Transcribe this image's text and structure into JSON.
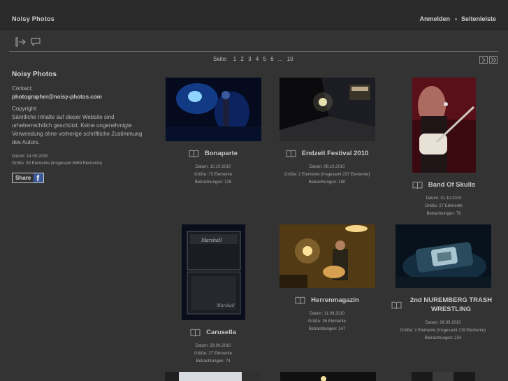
{
  "header": {
    "site_title": "Noisy Photos",
    "login": "Anmelden",
    "sitemap": "Seitenleiste"
  },
  "pager": {
    "label": "Seite:",
    "pages": [
      "1",
      "2",
      "3",
      "4",
      "5",
      "6",
      "...",
      "10"
    ]
  },
  "sidebar": {
    "title": "Noisy Photos",
    "contact_label": "Contact:",
    "contact_email": "photographer@noisy-photos.com",
    "copyright_label": "Copyright:",
    "copyright_text": "Sämtliche Inhalte auf dieser Website sind urheberrechtlich geschützt. Keine ungenehmigte Verwendung ohne vorherige schriftliche Zustimmung des Autors.",
    "date_line": "Datum: 14.09.2008",
    "size_line": "Größe: 83 Elemente (insgesamt 6069 Elemente)",
    "share_label": "Share"
  },
  "galleries": [
    {
      "title": "Bonaparte",
      "date": "Datum: 10.10.2010",
      "size": "Größe: 73 Elemente",
      "views": "Betrachtungen: 125"
    },
    {
      "title": "Endzeit Festival 2010",
      "date": "Datum: 08.10.2010",
      "size": "Größe: 2 Elemente (insgesamt 237 Elemente)",
      "views": "Betrachtungen: 180"
    },
    {
      "title": "Band Of Skulls",
      "date": "Datum: 01.10.2010",
      "size": "Größe: 27 Elemente",
      "views": "Betrachtungen: 79"
    },
    {
      "title": "Carusella",
      "date": "Datum: 29.09.2010",
      "size": "Größe: 27 Elemente",
      "views": "Betrachtungen: 74"
    },
    {
      "title": "Herrenmagazin",
      "date": "Datum: 11.09.2010",
      "size": "Größe: 36 Elemente",
      "views": "Betrachtungen: 147"
    },
    {
      "title": "2nd NUREMBERG TRASH WRESTLING",
      "date": "Datum: 06.09.2010",
      "size": "Größe: 2 Elemente (insgesamt 219 Elemente)",
      "views": "Betrachtungen: 234"
    }
  ],
  "icons": {
    "toolbar": [
      "exit-icon",
      "comment-icon"
    ],
    "caption": "album-book-icon",
    "nav": [
      "next-page-icon",
      "last-page-icon"
    ]
  },
  "colors": {
    "background": "#333333",
    "topbar": "#2b2b2b",
    "text": "#c8c8c8",
    "facebook": "#3b5998"
  }
}
